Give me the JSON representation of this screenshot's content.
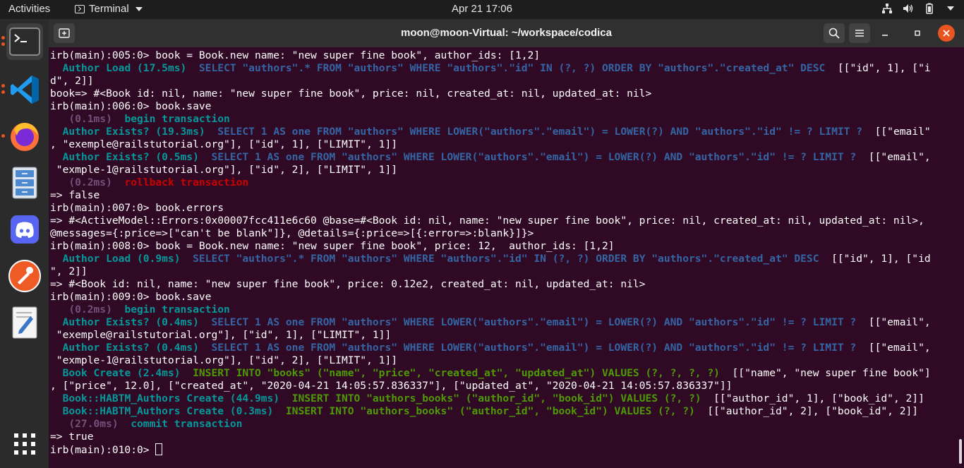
{
  "topbar": {
    "activities": "Activities",
    "app_name": "Terminal",
    "clock": "Apr 21  17:06",
    "icons": [
      "network-icon",
      "volume-icon",
      "battery-icon",
      "power-menu-icon"
    ]
  },
  "dock": {
    "items": [
      {
        "name": "terminal-app",
        "icon": "terminal-icon"
      },
      {
        "name": "vscode-app",
        "icon": "vscode-icon"
      },
      {
        "name": "firefox-app",
        "icon": "firefox-icon"
      },
      {
        "name": "files-app",
        "icon": "file-cabinet-icon"
      },
      {
        "name": "discord-app",
        "icon": "discord-icon"
      },
      {
        "name": "postman-app",
        "icon": "postman-icon"
      },
      {
        "name": "text-editor-app",
        "icon": "text-editor-icon"
      },
      {
        "name": "show-applications",
        "icon": "grid-icon"
      }
    ]
  },
  "window": {
    "title": "moon@moon-Virtual: ~/workspace/codica",
    "buttons": [
      "new-tab-icon",
      "search-icon",
      "hamburger-menu-icon",
      "minimize-icon",
      "maximize-icon",
      "close-icon"
    ]
  },
  "colors": {
    "background": "#300a24",
    "cyan": "#06989a",
    "blue": "#3465a4",
    "magenta": "#75507b",
    "red": "#cc0000",
    "green": "#4e9a06",
    "close_button": "#e95420"
  },
  "terminal": {
    "lines": [
      [
        {
          "t": "irb(main):005:0> book = Book.new name: \"new super fine book\", author_ids: [1,2]"
        }
      ],
      [
        {
          "t": "  "
        },
        {
          "t": "Author Load (17.5ms)",
          "c": "cyan"
        },
        {
          "t": "  "
        },
        {
          "t": "SELECT \"authors\".* FROM \"authors\" WHERE \"authors\".\"id\" IN (?, ?) ORDER BY \"authors\".\"created_at\" DESC",
          "c": "blue"
        },
        {
          "t": "  [[\"id\", 1], [\"i"
        }
      ],
      [
        {
          "t": "d\", 2]]"
        }
      ],
      [
        {
          "t": "book=> #<Book id: nil, name: \"new super fine book\", price: nil, created_at: nil, updated_at: nil>"
        }
      ],
      [
        {
          "t": "irb(main):006:0> book.save"
        }
      ],
      [
        {
          "t": "   "
        },
        {
          "t": "(0.1ms)",
          "c": "magenta"
        },
        {
          "t": "  "
        },
        {
          "t": "begin transaction",
          "c": "cyan"
        }
      ],
      [
        {
          "t": "  "
        },
        {
          "t": "Author Exists? (19.3ms)",
          "c": "cyan"
        },
        {
          "t": "  "
        },
        {
          "t": "SELECT 1 AS one FROM \"authors\" WHERE LOWER(\"authors\".\"email\") = LOWER(?) AND \"authors\".\"id\" != ? LIMIT ?",
          "c": "blue"
        },
        {
          "t": "  [[\"email\""
        }
      ],
      [
        {
          "t": ", \"exemple@railstutorial.org\"], [\"id\", 1], [\"LIMIT\", 1]]"
        }
      ],
      [
        {
          "t": "  "
        },
        {
          "t": "Author Exists? (0.5ms)",
          "c": "cyan"
        },
        {
          "t": "  "
        },
        {
          "t": "SELECT 1 AS one FROM \"authors\" WHERE LOWER(\"authors\".\"email\") = LOWER(?) AND \"authors\".\"id\" != ? LIMIT ?",
          "c": "blue"
        },
        {
          "t": "  [[\"email\","
        }
      ],
      [
        {
          "t": " \"exmple-1@railstutorial.org\"], [\"id\", 2], [\"LIMIT\", 1]]"
        }
      ],
      [
        {
          "t": "   "
        },
        {
          "t": "(0.2ms)",
          "c": "magenta"
        },
        {
          "t": "  "
        },
        {
          "t": "rollback transaction",
          "c": "red"
        }
      ],
      [
        {
          "t": "=> false"
        }
      ],
      [
        {
          "t": "irb(main):007:0> book.errors"
        }
      ],
      [
        {
          "t": "=> #<ActiveModel::Errors:0x00007fcc411e6c60 @base=#<Book id: nil, name: \"new super fine book\", price: nil, created_at: nil, updated_at: nil>,"
        }
      ],
      [
        {
          "t": "@messages={:price=>[\"can't be blank\"]}, @details={:price=>[{:error=>:blank}]}>"
        }
      ],
      [
        {
          "t": "irb(main):008:0> book = Book.new name: \"new super fine book\", price: 12,  author_ids: [1,2]"
        }
      ],
      [
        {
          "t": "  "
        },
        {
          "t": "Author Load (0.9ms)",
          "c": "cyan"
        },
        {
          "t": "  "
        },
        {
          "t": "SELECT \"authors\".* FROM \"authors\" WHERE \"authors\".\"id\" IN (?, ?) ORDER BY \"authors\".\"created_at\" DESC",
          "c": "blue"
        },
        {
          "t": "  [[\"id\", 1], [\"id"
        }
      ],
      [
        {
          "t": "\", 2]]"
        }
      ],
      [
        {
          "t": "=> #<Book id: nil, name: \"new super fine book\", price: 0.12e2, created_at: nil, updated_at: nil>"
        }
      ],
      [
        {
          "t": "irb(main):009:0> book.save"
        }
      ],
      [
        {
          "t": "   "
        },
        {
          "t": "(0.2ms)",
          "c": "magenta"
        },
        {
          "t": "  "
        },
        {
          "t": "begin transaction",
          "c": "cyan"
        }
      ],
      [
        {
          "t": "  "
        },
        {
          "t": "Author Exists? (0.4ms)",
          "c": "cyan"
        },
        {
          "t": "  "
        },
        {
          "t": "SELECT 1 AS one FROM \"authors\" WHERE LOWER(\"authors\".\"email\") = LOWER(?) AND \"authors\".\"id\" != ? LIMIT ?",
          "c": "blue"
        },
        {
          "t": "  [[\"email\","
        }
      ],
      [
        {
          "t": " \"exemple@railstutorial.org\"], [\"id\", 1], [\"LIMIT\", 1]]"
        }
      ],
      [
        {
          "t": "  "
        },
        {
          "t": "Author Exists? (0.4ms)",
          "c": "cyan"
        },
        {
          "t": "  "
        },
        {
          "t": "SELECT 1 AS one FROM \"authors\" WHERE LOWER(\"authors\".\"email\") = LOWER(?) AND \"authors\".\"id\" != ? LIMIT ?",
          "c": "blue"
        },
        {
          "t": "  [[\"email\","
        }
      ],
      [
        {
          "t": " \"exmple-1@railstutorial.org\"], [\"id\", 2], [\"LIMIT\", 1]]"
        }
      ],
      [
        {
          "t": "  "
        },
        {
          "t": "Book Create (2.4ms)",
          "c": "cyan"
        },
        {
          "t": "  "
        },
        {
          "t": "INSERT INTO \"books\" (\"name\", \"price\", \"created_at\", \"updated_at\") VALUES (?, ?, ?, ?)",
          "c": "green"
        },
        {
          "t": "  [[\"name\", \"new super fine book\"]"
        }
      ],
      [
        {
          "t": ", [\"price\", 12.0], [\"created_at\", \"2020-04-21 14:05:57.836337\"], [\"updated_at\", \"2020-04-21 14:05:57.836337\"]]"
        }
      ],
      [
        {
          "t": "  "
        },
        {
          "t": "Book::HABTM_Authors Create (44.9ms)",
          "c": "cyan"
        },
        {
          "t": "  "
        },
        {
          "t": "INSERT INTO \"authors_books\" (\"author_id\", \"book_id\") VALUES (?, ?)",
          "c": "green"
        },
        {
          "t": "  [[\"author_id\", 1], [\"book_id\", 2]]"
        }
      ],
      [
        {
          "t": "  "
        },
        {
          "t": "Book::HABTM_Authors Create (0.3ms)",
          "c": "cyan"
        },
        {
          "t": "  "
        },
        {
          "t": "INSERT INTO \"authors_books\" (\"author_id\", \"book_id\") VALUES (?, ?)",
          "c": "green"
        },
        {
          "t": "  [[\"author_id\", 2], [\"book_id\", 2]]"
        }
      ],
      [
        {
          "t": "   "
        },
        {
          "t": "(27.0ms)",
          "c": "magenta"
        },
        {
          "t": "  "
        },
        {
          "t": "commit transaction",
          "c": "cyan"
        }
      ],
      [
        {
          "t": "=> true"
        }
      ],
      [
        {
          "t": "irb(main):010:0> "
        }
      ]
    ]
  }
}
